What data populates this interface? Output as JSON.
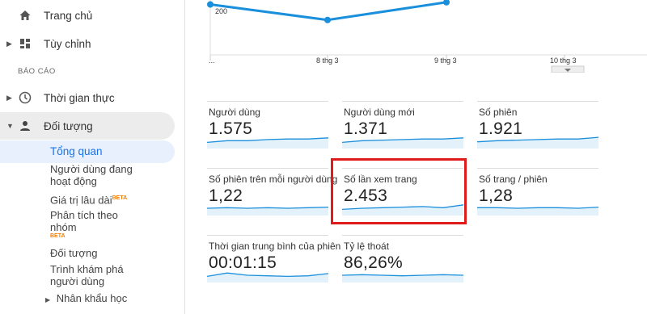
{
  "sidebar": {
    "home": "Trang chủ",
    "customize": "Tùy chỉnh",
    "reports_header": "BÁO CÁO",
    "realtime": "Thời gian thực",
    "audience": "Đối tượng",
    "sub": {
      "overview": "Tổng quan",
      "active_users": "Người dùng đang hoạt động",
      "lifetime_value": "Giá trị lâu dài",
      "cohort": "Phân tích theo nhóm",
      "beta": "BETA",
      "audiences": "Đối tượng",
      "user_explorer": "Trình khám phá người dùng",
      "demographics": "Nhân khẩu học"
    }
  },
  "main_chart": {
    "y_tick": "200",
    "x_start": "...",
    "x_labels": [
      "8 thg 3",
      "9 thg 3",
      "10 thg 3"
    ],
    "points": [
      0.1,
      0.45,
      0.05
    ],
    "color": "#1a8fdc"
  },
  "metrics": [
    {
      "name": "Người dùng",
      "value": "1.575",
      "spark": [
        0.6,
        0.45,
        0.45,
        0.35,
        0.3,
        0.3,
        0.2
      ]
    },
    {
      "name": "Người dùng mới",
      "value": "1.371",
      "spark": [
        0.6,
        0.45,
        0.4,
        0.35,
        0.3,
        0.3,
        0.2
      ]
    },
    {
      "name": "Số phiên",
      "value": "1.921",
      "spark": [
        0.55,
        0.45,
        0.4,
        0.35,
        0.3,
        0.3,
        0.15
      ]
    },
    {
      "name": "Số phiên trên mỗi người dùng",
      "value": "1,22",
      "spark": [
        0.5,
        0.45,
        0.5,
        0.45,
        0.5,
        0.45,
        0.4
      ]
    },
    {
      "name": "Số lần xem trang",
      "value": "2.453",
      "spark": [
        0.6,
        0.5,
        0.45,
        0.4,
        0.35,
        0.45,
        0.2
      ]
    },
    {
      "name": "Số trang / phiên",
      "value": "1,28",
      "spark": [
        0.45,
        0.45,
        0.5,
        0.45,
        0.45,
        0.5,
        0.4
      ]
    },
    {
      "name": "Thời gian trung bình của phiên",
      "value": "00:01:15",
      "spark": [
        0.6,
        0.3,
        0.5,
        0.55,
        0.6,
        0.55,
        0.35
      ]
    },
    {
      "name": "Tỷ lệ thoát",
      "value": "86,26%",
      "spark": [
        0.5,
        0.45,
        0.5,
        0.55,
        0.5,
        0.45,
        0.5
      ]
    }
  ],
  "accent": "#1a8fdc",
  "highlight_color": "#e01b1b"
}
